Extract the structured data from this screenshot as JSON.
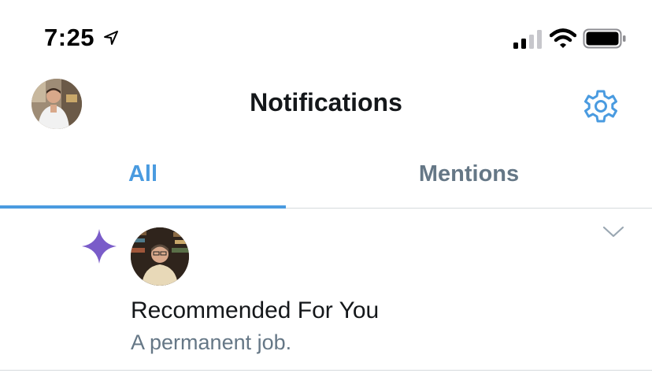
{
  "status_bar": {
    "time": "7:25",
    "icons": [
      "location-arrow-icon",
      "signal-icon",
      "wifi-icon",
      "battery-icon"
    ]
  },
  "header": {
    "title": "Notifications",
    "avatar": "profile-avatar",
    "settings_icon": "gear-icon"
  },
  "tabs": {
    "items": [
      {
        "label": "All",
        "selected": true
      },
      {
        "label": "Mentions",
        "selected": false
      }
    ]
  },
  "notifications": [
    {
      "icon": "sparkle-icon",
      "title": "Recommended For You",
      "text": "A permanent job.",
      "menu_icon": "chevron-down-icon"
    }
  ],
  "colors": {
    "accent": "#4a9be0",
    "secondary_text": "#657786",
    "primary_text": "#14171a",
    "sparkle": "#7a5cc9",
    "divider": "#d6dadd"
  }
}
